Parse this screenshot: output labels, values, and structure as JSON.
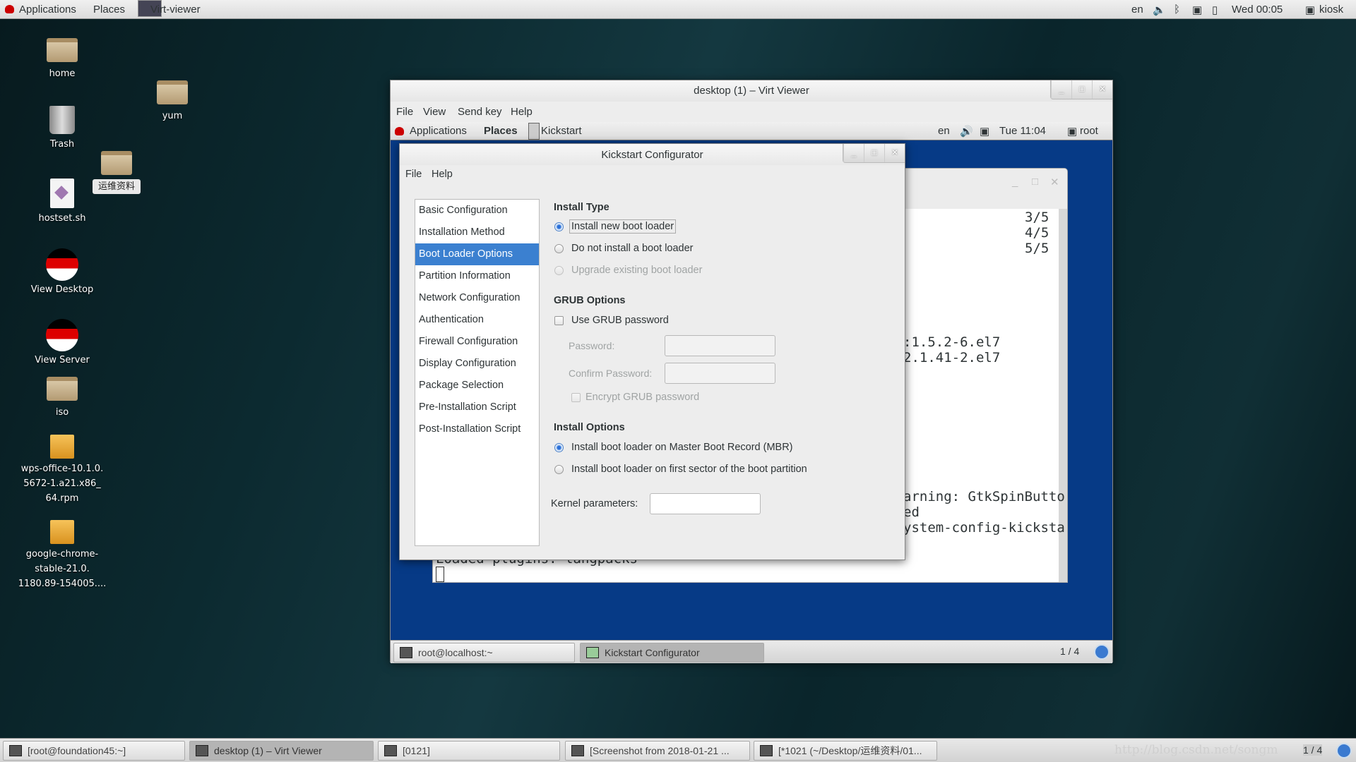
{
  "host_topbar": {
    "applications": "Applications",
    "places": "Places",
    "active_app": "Virt-viewer",
    "lang": "en",
    "clock": "Wed 00:05",
    "user": "kiosk"
  },
  "desktop_icons": [
    {
      "label": "home",
      "type": "folder-home"
    },
    {
      "label": "yum",
      "type": "folder"
    },
    {
      "label": "Trash",
      "type": "trash"
    },
    {
      "label": "运维资料",
      "type": "folder"
    },
    {
      "label": "hostset.sh",
      "type": "script"
    },
    {
      "label": "View Desktop",
      "type": "redhat"
    },
    {
      "label": "View Server",
      "type": "redhat"
    },
    {
      "label": "iso",
      "type": "folder-locked"
    },
    {
      "label": "wps-office-10.1.0.\n5672-1.a21.x86_\n64.rpm",
      "type": "package"
    },
    {
      "label": "google-chrome-\nstable-21.0.\n1180.89-154005....",
      "type": "package"
    }
  ],
  "virt_viewer": {
    "title": "desktop (1) – Virt Viewer",
    "menu": [
      "File",
      "View",
      "Send key",
      "Help"
    ],
    "guest_topbar": {
      "applications": "Applications",
      "places": "Places",
      "active_app": "Kickstart",
      "lang": "en",
      "clock": "Tue 11:04",
      "user": "root"
    },
    "terminal_lines": [
      "3/5",
      "4/5",
      "5/5",
      ":1.5.2-6.el7",
      "2.1.41-2.el7",
      "arning: GtkSpinButto",
      "ed",
      "ystem-config-kicksta",
      "Loaded plugins: langpacks"
    ],
    "guest_taskbar": {
      "items": [
        "root@localhost:~",
        "Kickstart Configurator"
      ],
      "workspace": "1 / 4"
    }
  },
  "kickstart": {
    "title": "Kickstart Configurator",
    "menu": [
      "File",
      "Help"
    ],
    "sidebar": [
      "Basic Configuration",
      "Installation Method",
      "Boot Loader Options",
      "Partition Information",
      "Network Configuration",
      "Authentication",
      "Firewall Configuration",
      "Display Configuration",
      "Package Selection",
      "Pre-Installation Script",
      "Post-Installation Script"
    ],
    "selected": "Boot Loader Options",
    "install_type": {
      "header": "Install Type",
      "options": [
        "Install new boot loader",
        "Do not install a boot loader",
        "Upgrade existing boot loader"
      ],
      "selected": "Install new boot loader"
    },
    "grub": {
      "header": "GRUB Options",
      "use_password": "Use GRUB password",
      "use_password_checked": false,
      "password_label": "Password:",
      "password_value": "",
      "confirm_label": "Confirm Password:",
      "confirm_value": "",
      "encrypt": "Encrypt GRUB password",
      "encrypt_checked": false
    },
    "install_options": {
      "header": "Install Options",
      "options": [
        "Install boot loader on Master Boot Record (MBR)",
        "Install boot loader on first sector of the boot partition"
      ],
      "selected": "Install boot loader on Master Boot Record (MBR)"
    },
    "kernel_label": "Kernel parameters:",
    "kernel_value": ""
  },
  "host_taskbar": {
    "items": [
      "[root@foundation45:~]",
      "desktop (1) – Virt Viewer",
      "[0121]",
      "[Screenshot from 2018-01-21 ...",
      "[*1021 (~/Desktop/运维资料/01..."
    ],
    "watermark": "http://blog.csdn.net/songm",
    "workspace": "1 / 4"
  },
  "colors": {
    "selection": "#3b80d0",
    "guest_desktop": "#063a86"
  }
}
